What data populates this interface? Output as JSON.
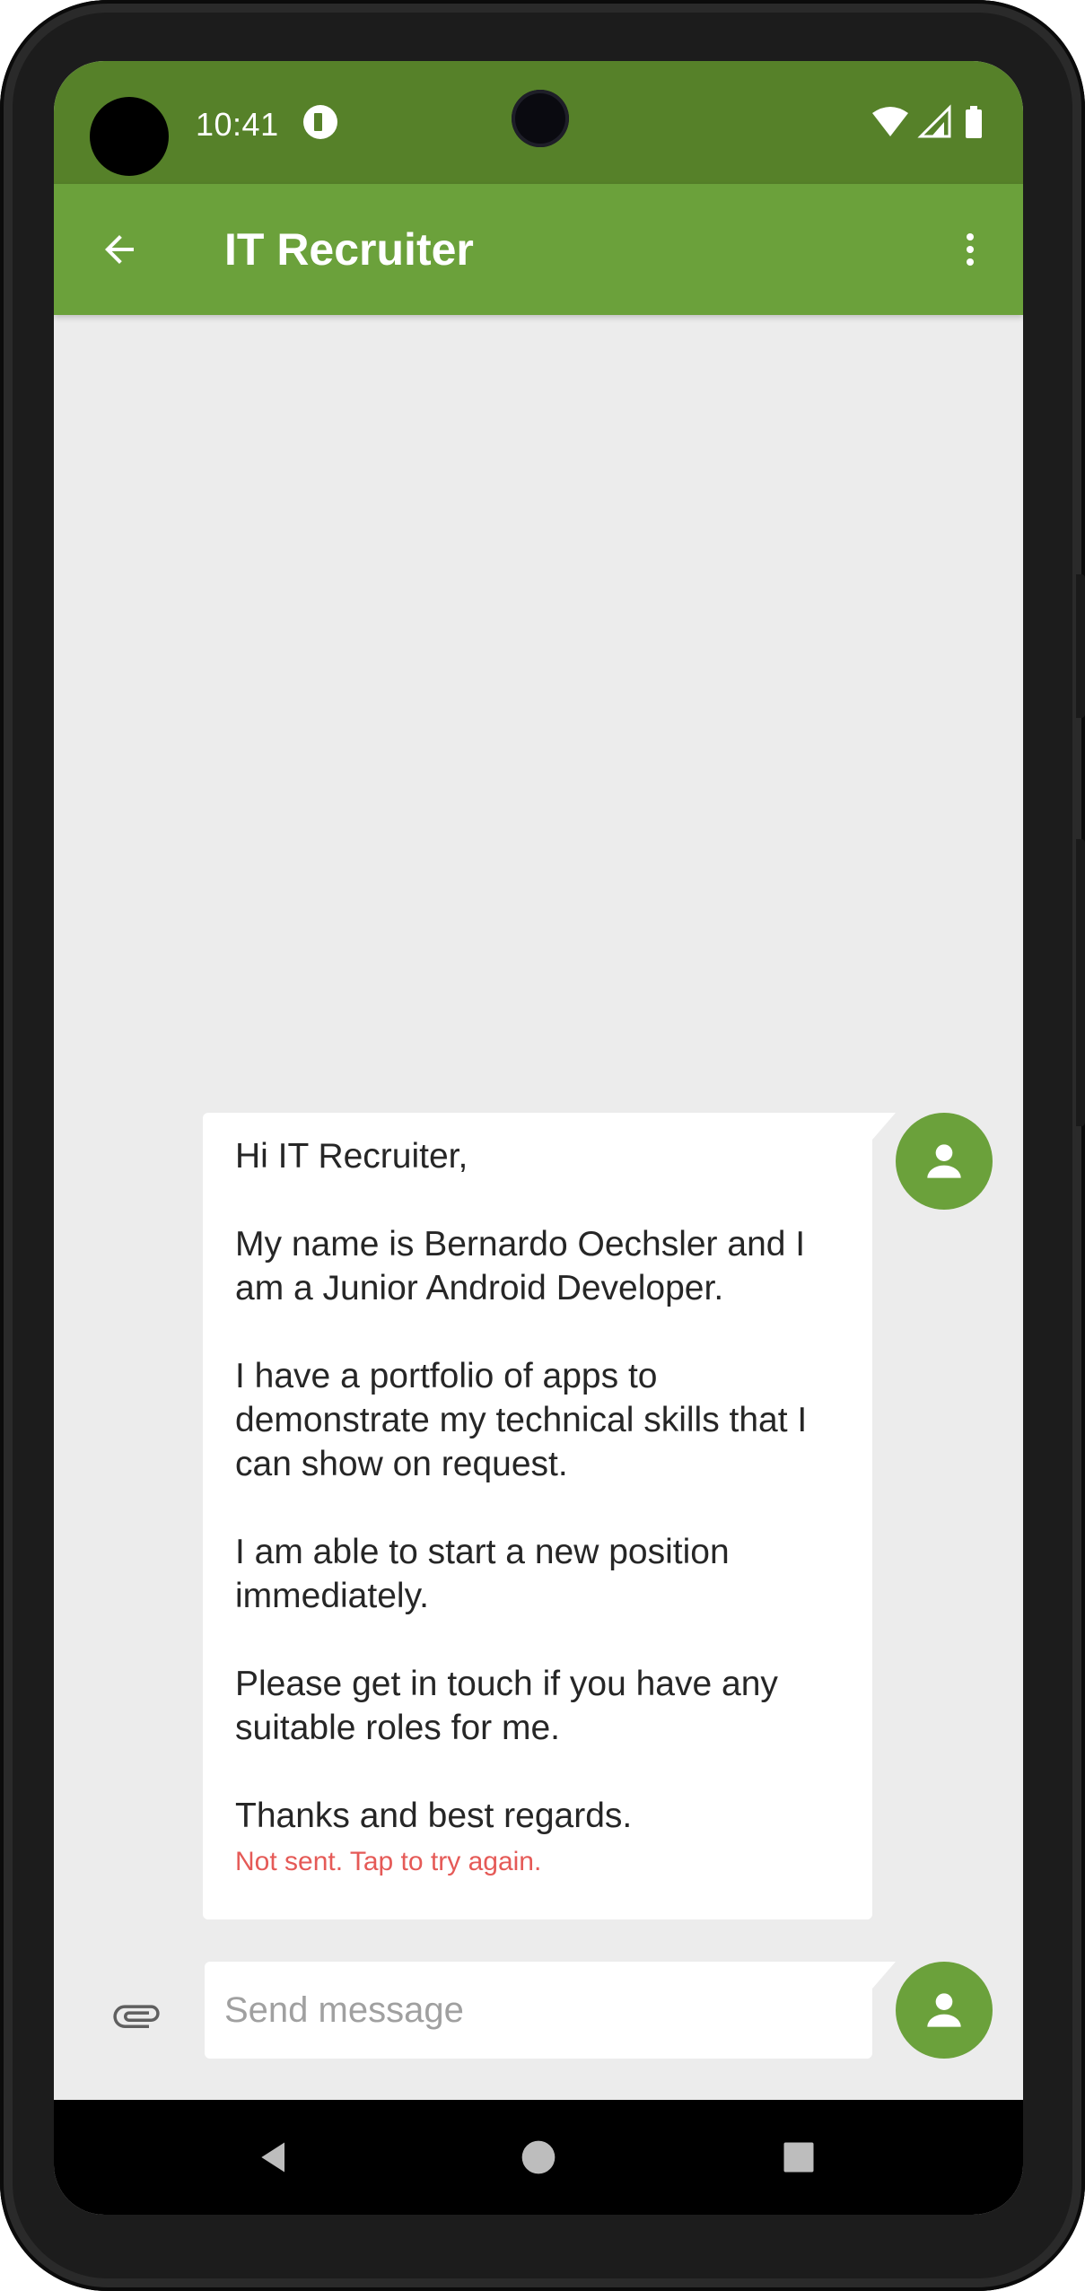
{
  "status_bar": {
    "time": "10:41"
  },
  "toolbar": {
    "title": "IT Recruiter"
  },
  "conversation": {
    "messages": [
      {
        "text": "Hi IT Recruiter,\n\nMy name is Bernardo Oechsler and I am a Junior Android Developer.\n\nI have a portfolio of apps to demonstrate my technical skills that I can show on request.\n\nI am able to start a new position immediately.\n\nPlease get in touch if you have any suitable roles for me.\n\nThanks and best regards.",
        "status": "Not sent. Tap to try again."
      }
    ]
  },
  "composer": {
    "placeholder": "Send message",
    "value": ""
  },
  "colors": {
    "status_bar": "#568129",
    "toolbar": "#6ba13b",
    "avatar": "#6ba13b",
    "background": "#ececec",
    "error_text": "#e55a57"
  },
  "icons": {
    "back": "arrow-back-icon",
    "overflow": "more-vert-icon",
    "avatar": "person-icon",
    "attach": "paperclip-icon",
    "nav_back": "triangle-back-icon",
    "nav_home": "circle-home-icon",
    "nav_recents": "square-recents-icon"
  }
}
